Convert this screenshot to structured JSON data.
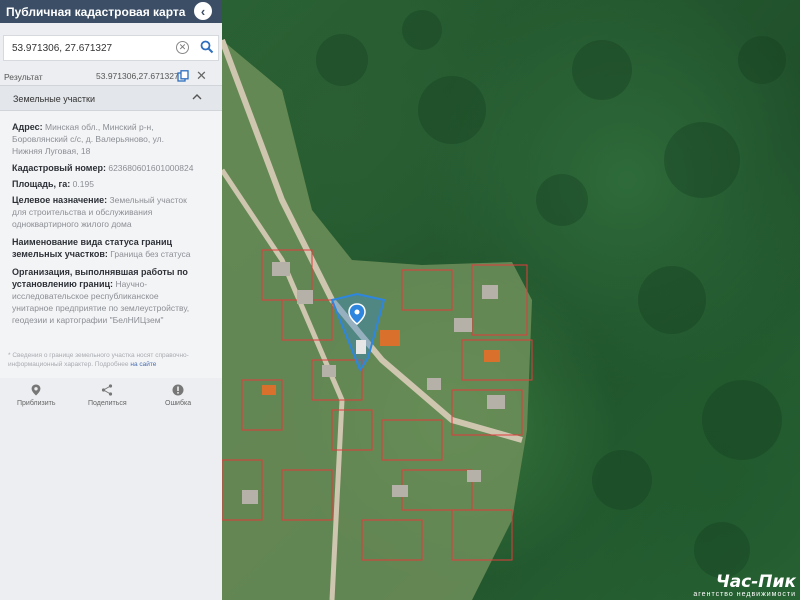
{
  "header": {
    "title": "Публичная кадастровая карта",
    "collapse_icon": "chevron-left-icon"
  },
  "search": {
    "value": "53.971306, 27.671327"
  },
  "result": {
    "label": "Результат",
    "coords": "53.971306,27.671327"
  },
  "section": {
    "title": "Земельные участки"
  },
  "info": {
    "address_key": "Адрес:",
    "address_val_1": "Минская обл., Минский р-н,",
    "address_val_2": "Боровлянский с/с, д. Валерьяново, ул.",
    "address_val_3": "Нижняя Луговая, 18",
    "cadastre_key": "Кадастровый номер:",
    "cadastre_val": "623680601601000824",
    "area_key": "Площадь, га:",
    "area_val": "0.195",
    "purpose_key": "Целевое назначение:",
    "purpose_val_1": "Земельный участок",
    "purpose_val_2": "для строительства и обслуживания",
    "purpose_val_3": "одноквартирного жилого дома",
    "status_key_1": "Наименование вида статуса границ",
    "status_key_2": "земельных участков:",
    "status_val": "Граница без статуса",
    "org_key_1": "Организация, выполнявшая работы по",
    "org_key_2": "установлению границ:",
    "org_val_1": "Научно-",
    "org_val_2": "исследовательское республиканское",
    "org_val_3": "унитарное предприятие по землеустройству,",
    "org_val_4": "геодезии и картографии \"БелНИЦзем\"",
    "note_1": "* Сведения о границе земельного участка носят справочно-",
    "note_2": "информационный характер. Подробнее",
    "note_link": "на сайте"
  },
  "actions": [
    {
      "label": "Приблизить",
      "icon": "location-pin-icon"
    },
    {
      "label": "Поделиться",
      "icon": "share-icon"
    },
    {
      "label": "Ошибка",
      "icon": "error-icon"
    }
  ],
  "watermark": {
    "title": "Час-Пик",
    "subtitle": "агентство недвижимости"
  },
  "colors": {
    "header": "#3b4e66",
    "accent": "#2e86de",
    "parcel_outline": "#e23b3b"
  }
}
